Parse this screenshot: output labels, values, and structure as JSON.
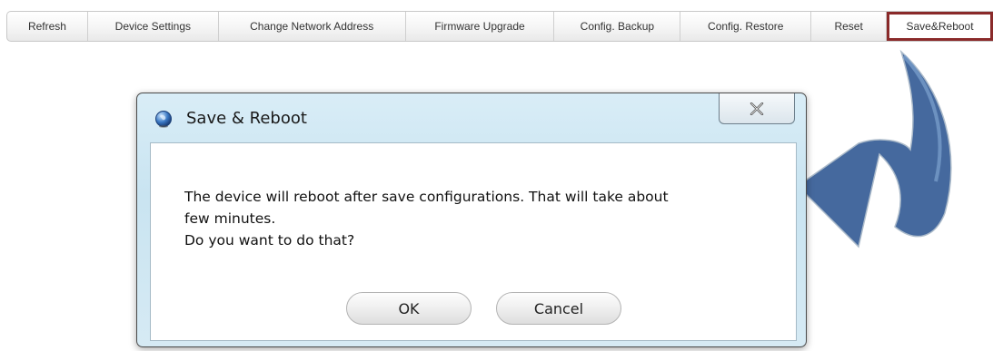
{
  "toolbar": {
    "items": [
      {
        "label": "Refresh"
      },
      {
        "label": "Device Settings"
      },
      {
        "label": "Change Network Address"
      },
      {
        "label": "Firmware Upgrade"
      },
      {
        "label": "Config. Backup"
      },
      {
        "label": "Config. Restore"
      },
      {
        "label": "Reset"
      },
      {
        "label": "Save&Reboot",
        "active": true
      }
    ]
  },
  "dialog": {
    "title": "Save & Reboot",
    "message_line1": "The device will reboot after save configurations. That will take about",
    "message_line2": "few minutes.",
    "message_line3": "Do you want to do that?",
    "ok_label": "OK",
    "cancel_label": "Cancel",
    "close_icon": "close-x-icon"
  },
  "colors": {
    "highlight_border": "#8a2a2a",
    "arrow": "#3c6299",
    "dialog_frame": "#d9edf7"
  }
}
